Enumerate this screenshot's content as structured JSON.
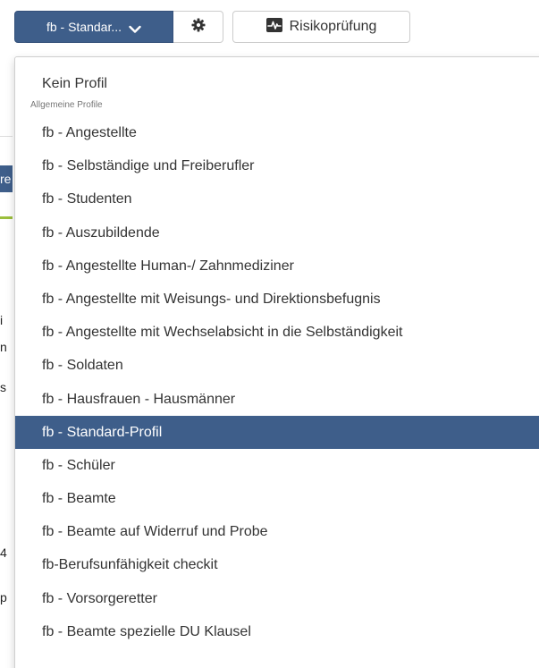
{
  "toolbar": {
    "profile_select_label": "fb - Standar...",
    "risk_button_label": "Risikoprüfung"
  },
  "icons": {
    "profile_chevron": "chevron-down-icon",
    "settings": "gear-icon",
    "risk": "heartbeat-icon"
  },
  "colors": {
    "accent": "#3e5e8a",
    "text": "#333333",
    "header_text": "#777777"
  },
  "dropdown": {
    "no_profile": "Kein Profil",
    "section_header": "Allgemeine Profile",
    "selected": "fb - Standard-Profil",
    "items": [
      "fb - Angestellte",
      "fb - Selbständige und Freiberufler",
      "fb - Studenten",
      "fb - Auszubildende",
      "fb - Angestellte Human-/ Zahnmediziner",
      "fb - Angestellte mit Weisungs- und Direktionsbefugnis",
      "fb - Angestellte mit Wechselabsicht in die Selbständigkeit",
      "fb - Soldaten",
      "fb - Hausfrauen - Hausmänner",
      "fb - Standard-Profil",
      "fb - Schüler",
      "fb - Beamte",
      "fb - Beamte auf Widerruf und Probe",
      "fb-Berufsunfähigkeit checkit",
      "fb - Vorsorgeretter",
      "fb - Beamte spezielle DU Klausel"
    ]
  },
  "background": {
    "fragments": [
      "re",
      "i",
      "n",
      "s",
      "4",
      "p"
    ]
  }
}
